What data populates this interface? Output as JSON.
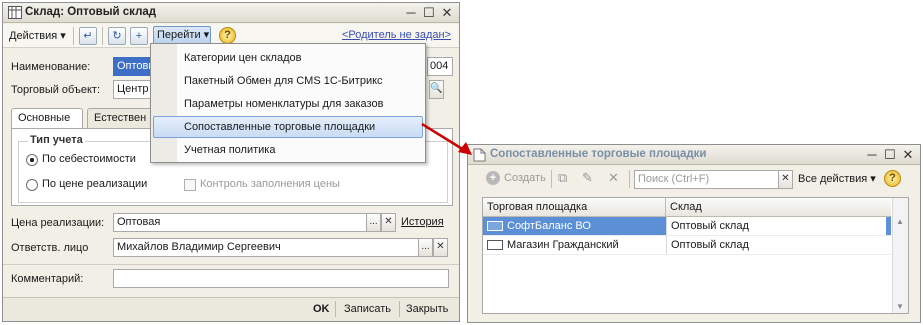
{
  "win1": {
    "title": "Склад: Оптовый склад",
    "toolbar": {
      "actions_label": "Действия",
      "goto_label": "Перейти",
      "help_glyph": "?",
      "parent_link": "<Родитель не задан>"
    },
    "fields": {
      "name_label": "Наименование:",
      "name_value": "Оптовы",
      "code_value": "004",
      "trade_object_label": "Торговый объект:",
      "trade_object_value": "Центр"
    },
    "tabs": [
      "Основные",
      "Естествен"
    ],
    "account_type": {
      "title": "Тип учета",
      "options": [
        "По себестоимости",
        "По цене реализации"
      ],
      "selected": "По себестоимости",
      "price_control_label": "Контроль заполнения цены"
    },
    "price": {
      "label": "Цена реализации:",
      "value": "Оптовая",
      "history_link": "История",
      "button_glyph": "..."
    },
    "responsible": {
      "label": "Ответств. лицо",
      "value": "Михайлов Владимир Сергеевич"
    },
    "comment": {
      "label": "Комментарий:",
      "value": ""
    },
    "footer": {
      "ok": "OK",
      "save": "Записать",
      "close": "Закрыть"
    }
  },
  "menu": {
    "items": [
      "Категории цен складов",
      "Пакетный Обмен для CMS 1С-Битрикс",
      "Параметры номенклатуры для заказов",
      "Сопоставленные торговые площадки",
      "Учетная политика"
    ],
    "highlighted_index": 3
  },
  "win2": {
    "title": "Сопоставленные торговые площадки",
    "toolbar": {
      "create_label": "Создать",
      "search_placeholder": "Поиск (Ctrl+F)",
      "all_actions_label": "Все действия"
    },
    "columns": [
      "Торговая площадка",
      "Склад"
    ],
    "rows": [
      {
        "platform": "СофтБаланс ВО",
        "warehouse": "Оптовый склад",
        "selected": true
      },
      {
        "platform": "Магазин Гражданский",
        "warehouse": "Оптовый склад",
        "selected": false
      }
    ]
  },
  "colors": {
    "window_bg": "#f1efe6",
    "selection": "#5b8fd6",
    "menu_highlight": "#c9dcf5",
    "arrow": "#cc0000"
  }
}
